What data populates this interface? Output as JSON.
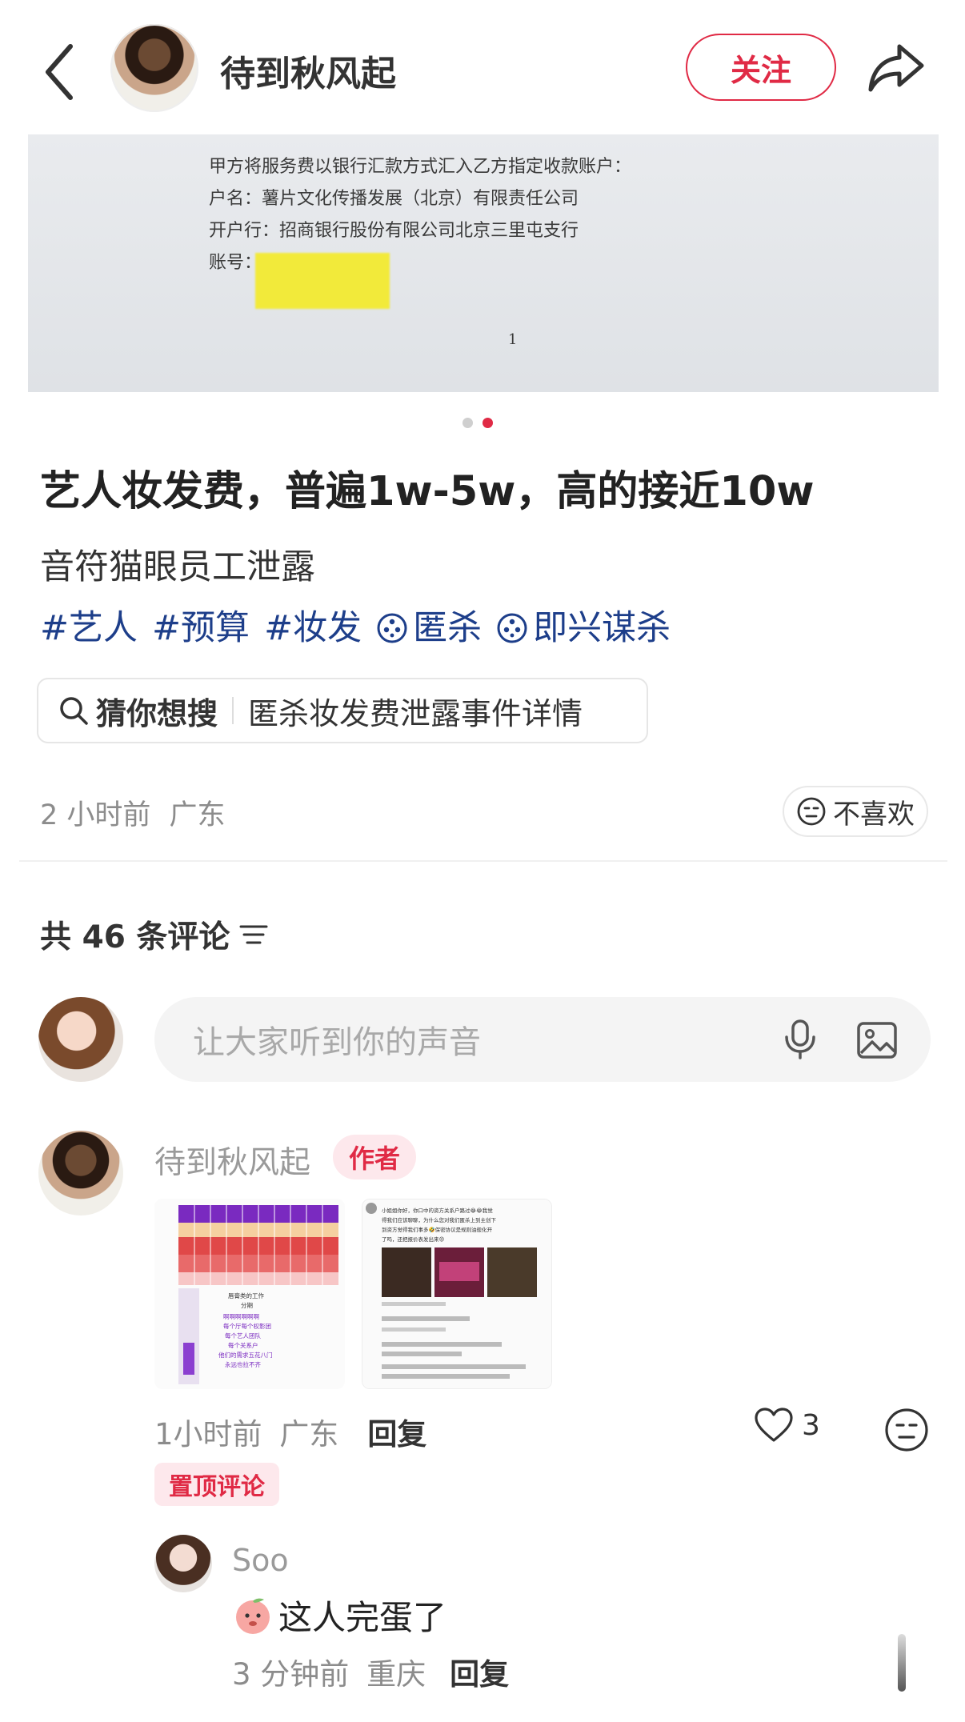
{
  "header": {
    "author_name": "待到秋风起",
    "follow_label": "关注"
  },
  "post": {
    "document_lines": [
      "甲方将服务费以银行汇款方式汇入乙方指定收款账户：",
      "户名：薯片文化传播发展（北京）有限责任公司",
      "开户行：招商银行股份有限公司北京三里屯支行",
      "账号：",
      "1"
    ],
    "image_index": 2,
    "image_count": 2,
    "title": "艺人妆发费，普遍1w-5w，高的接近10w",
    "subtitle": "音符猫眼员工泄露",
    "tags": [
      "#艺人",
      "#预算",
      "#妆发"
    ],
    "movie_tags": [
      "匿杀",
      "即兴谋杀"
    ],
    "guess_label": "猜你想搜",
    "guess_query": "匿杀妆发费泄露事件详情",
    "time": "2 小时前",
    "location": "广东",
    "dislike_label": "不喜欢"
  },
  "comments_section": {
    "count_label": "共 46 条评论",
    "input_placeholder": "让大家听到你的声音"
  },
  "comments": [
    {
      "name": "待到秋风起",
      "badge": "作者",
      "time": "1小时前",
      "location": "广东",
      "reply_label": "回复",
      "likes": "3",
      "pinned_label": "置顶评论",
      "thumb1_lines": [
        "唇膏类的工作",
        "分期",
        "啊啊啊啊啊啊",
        "每个厅每个权影团",
        "每个艺人团队",
        "每个关系户",
        "他们的需求五花八门",
        "永远也拉不齐"
      ],
      "thumb2_lines": [
        "小姐姐你好，你口中的资方关系户路过😂😂我觉",
        "得我们应该聊聊，为什么您对我们匿杀上到主创下",
        "到资方觉得我们事多🤣保密协议是规则油般化开",
        "了吗，还把报价表发出来😡"
      ],
      "replies": [
        {
          "name": "Soo",
          "text": "这人完蛋了",
          "time": "3 分钟前",
          "location": "重庆",
          "reply_label": "回复"
        }
      ]
    }
  ]
}
